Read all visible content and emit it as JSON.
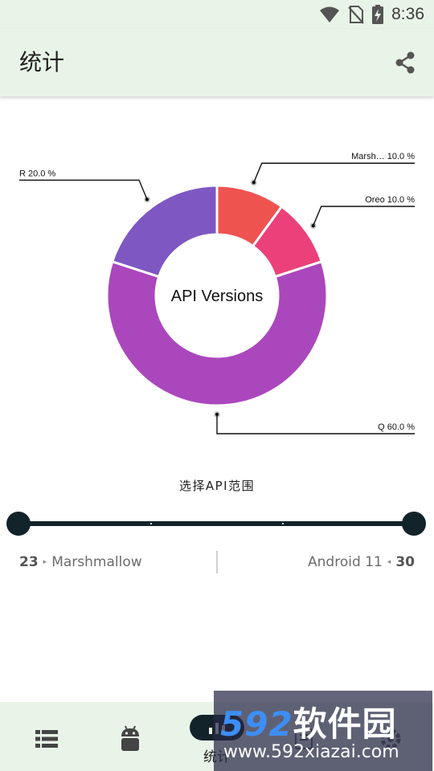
{
  "status_bar": {
    "time": "8:36",
    "icons": [
      "wifi-icon",
      "no-sim-icon",
      "battery-charging-icon"
    ]
  },
  "app_bar": {
    "title": "统计",
    "action_icon": "share-icon"
  },
  "chart_data": {
    "type": "pie",
    "title": "API Versions",
    "hole": "donut",
    "categories": [
      "Marsh...",
      "Oreo",
      "Q",
      "R"
    ],
    "values": [
      10.0,
      10.0,
      60.0,
      20.0
    ],
    "labels": [
      "Marsh… 10.0 %",
      "Oreo 10.0 %",
      "Q 60.0 %",
      "R 20.0 %"
    ],
    "colors": [
      "#ef5350",
      "#ec407a",
      "#ab47bc",
      "#7e57c2"
    ],
    "legend": "none"
  },
  "range": {
    "title": "选择API范围",
    "min_value": 23,
    "max_value": 30,
    "min_name": "Marshmallow",
    "max_name": "Android 11",
    "min_arrow": "▸",
    "max_arrow": "◂"
  },
  "bottom_nav": {
    "items": [
      {
        "icon": "list-icon",
        "label": ""
      },
      {
        "icon": "android-icon",
        "label": ""
      },
      {
        "icon": "chart-icon",
        "label": "统计",
        "selected": true
      },
      {
        "icon": "book-icon",
        "label": ""
      },
      {
        "icon": "settings-icon",
        "label": ""
      }
    ]
  },
  "watermark": {
    "number": "592",
    "brand": "软件园",
    "url": "www.592xiazai.com"
  }
}
